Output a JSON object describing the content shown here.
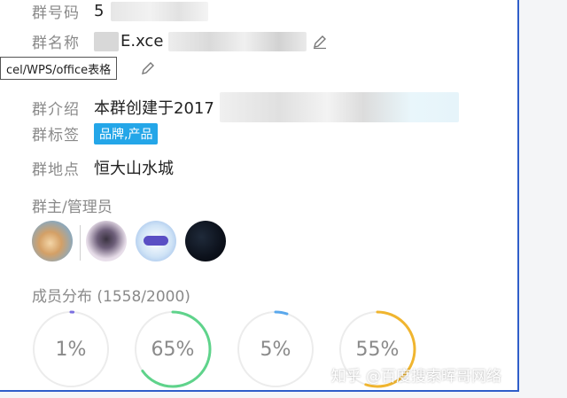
{
  "group_info": {
    "number_label": "群号码",
    "number_value": "5",
    "name_label": "群名称",
    "name_value": "E.xce",
    "tooltip": "cel/WPS/office表格",
    "intro_label": "群介绍",
    "intro_value": "本群创建于2017",
    "tags_label": "群标签",
    "tag": "品牌,产品",
    "location_label": "群地点",
    "location_value": "恒大山水城"
  },
  "admins": {
    "title": "群主/管理员"
  },
  "members": {
    "title": "成员分布 (1558/2000)",
    "stats": [
      {
        "label": "1%",
        "percent": 1,
        "color": "#7b6fe0"
      },
      {
        "label": "65%",
        "percent": 65,
        "color": "#5fd38b"
      },
      {
        "label": "5%",
        "percent": 5,
        "color": "#5aa8ec"
      },
      {
        "label": "55%",
        "percent": 55,
        "color": "#f0b52f"
      }
    ]
  },
  "watermark": "知乎 @百度搜索晖哥网络"
}
